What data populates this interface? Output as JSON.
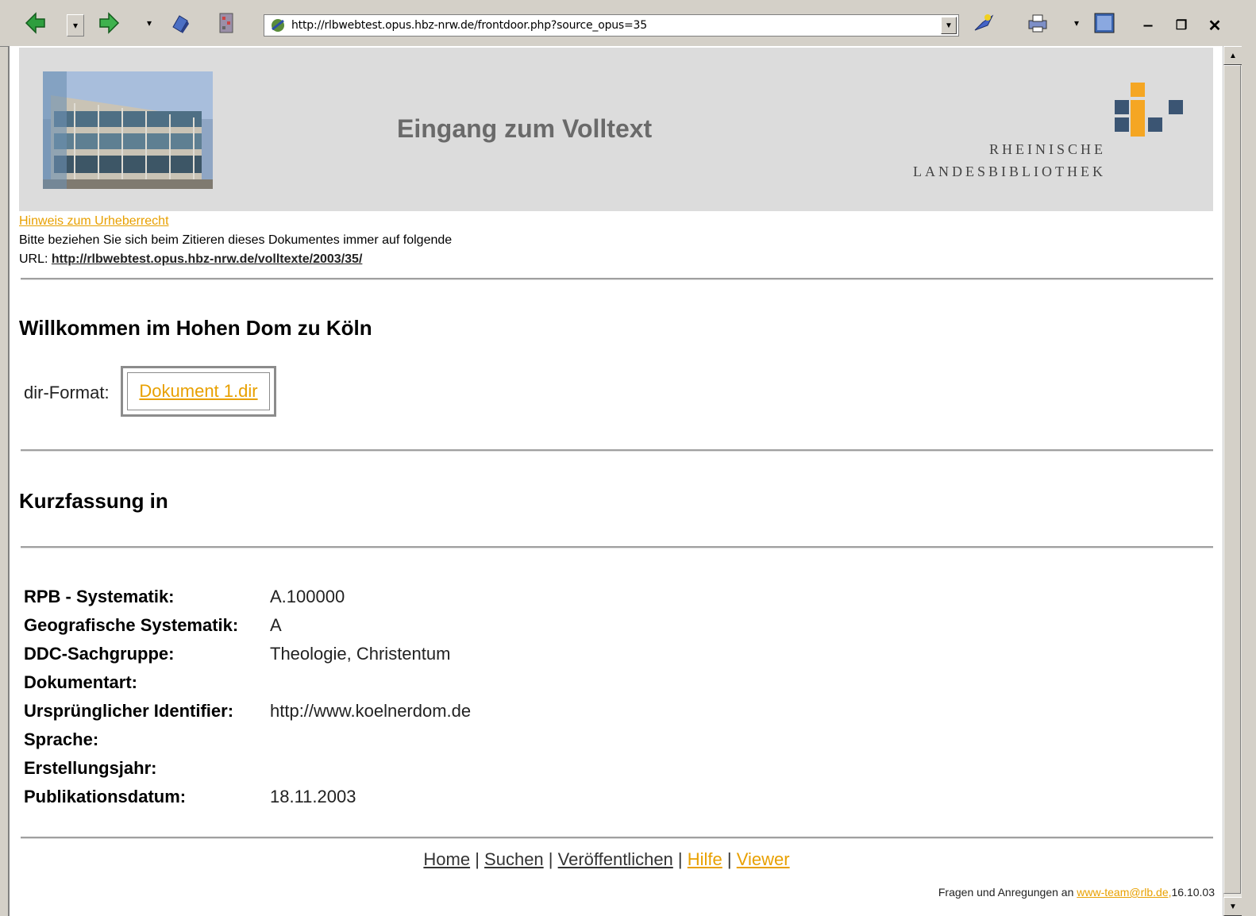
{
  "browser": {
    "address_url": "http://rlbwebtest.opus.hbz-nrw.de/frontdoor.php?source_opus=35"
  },
  "banner": {
    "title": "Eingang zum Volltext",
    "logo_line1": "RHEINISCHE",
    "logo_line2": "LANDESBIBLIOTHEK"
  },
  "notice": {
    "copyright_link": "Hinweis zum Urheberrecht",
    "cite_text": "Bitte beziehen Sie sich beim Zitieren dieses Dokumentes immer auf folgende",
    "url_label": "URL:",
    "url_link": "http://rlbwebtest.opus.hbz-nrw.de/volltexte/2003/35/"
  },
  "document": {
    "title": "Willkommen im Hohen Dom zu Köln",
    "format_label": "dir-Format:",
    "format_link": "Dokument 1.dir",
    "abstract_heading": "Kurzfassung in"
  },
  "metadata": [
    {
      "key": "RPB - Systematik:",
      "value": "A.100000"
    },
    {
      "key": "Geografische Systematik:",
      "value": "A"
    },
    {
      "key": "DDC-Sachgruppe:",
      "value": "Theologie, Christentum"
    },
    {
      "key": "Dokumentart:",
      "value": ""
    },
    {
      "key": "Ursprünglicher Identifier:",
      "value": "http://www.koelnerdom.de"
    },
    {
      "key": "Sprache:",
      "value": ""
    },
    {
      "key": "Erstellungsjahr:",
      "value": ""
    },
    {
      "key": "Publikationsdatum:",
      "value": "18.11.2003"
    }
  ],
  "footer": {
    "nav": [
      "Home",
      "Suchen",
      "Veröffentlichen",
      "Hilfe",
      "Viewer"
    ],
    "separator": "|",
    "contact_prefix": "Fragen und Anregungen an",
    "contact_email": "www-team@rlb.de,",
    "date": "16.10.03"
  },
  "colors": {
    "link_orange": "#e8a000",
    "banner_gray": "#dcdcdc",
    "logo_orange": "#f5a623",
    "logo_blue": "#3b5573"
  }
}
